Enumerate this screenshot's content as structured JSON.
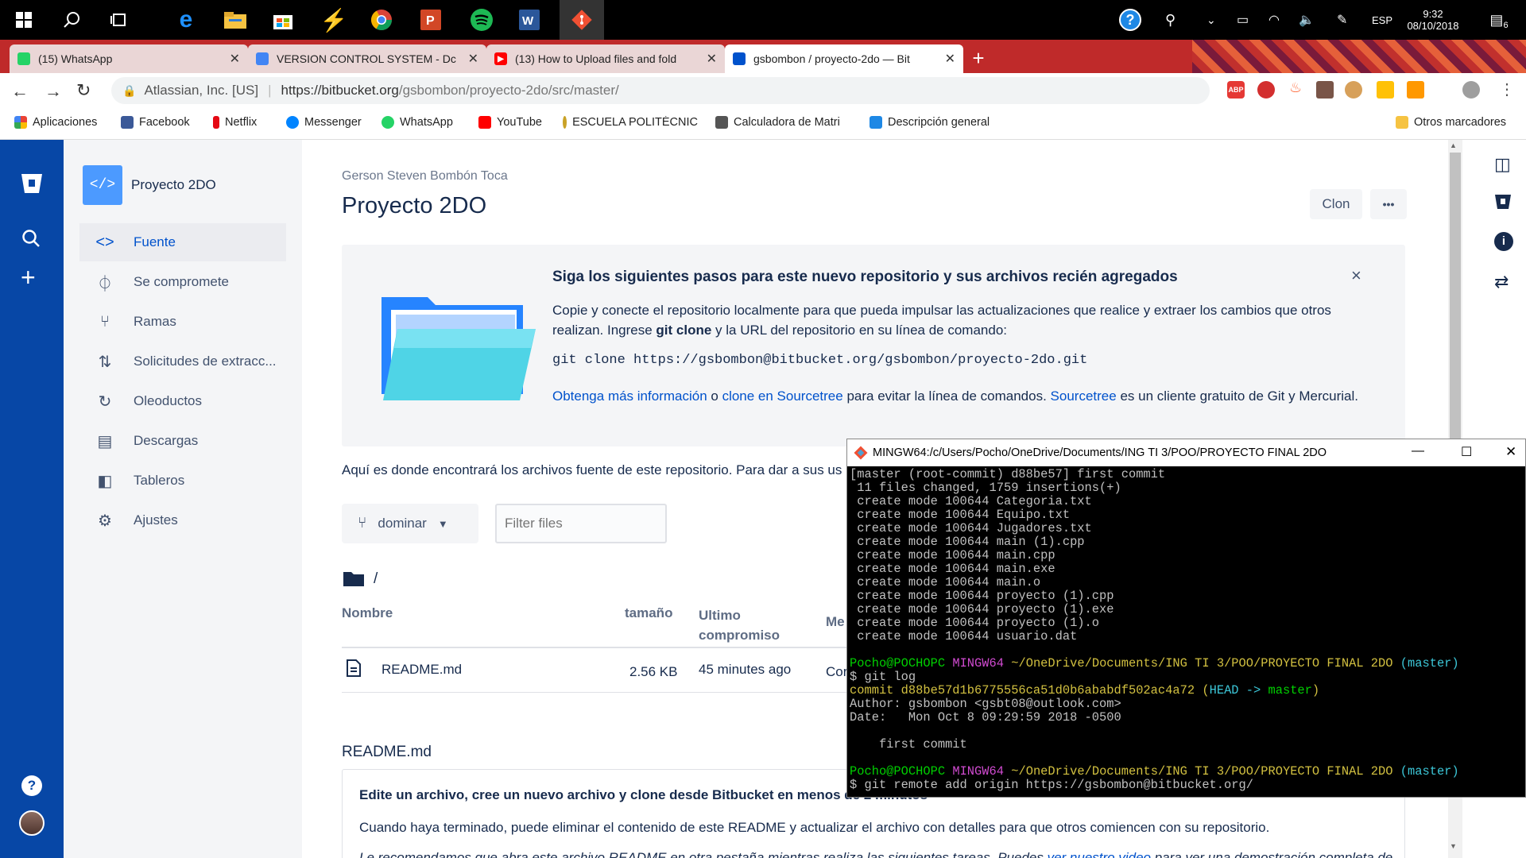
{
  "taskbar": {
    "lang": "ESP",
    "time": "9:32",
    "date": "08/10/2018",
    "notif": "6",
    "help": "?"
  },
  "tabs": [
    {
      "label": "(15) WhatsApp",
      "color": "#25d366"
    },
    {
      "label": "VERSION CONTROL SYSTEM - Dc",
      "color": "#4285f4"
    },
    {
      "label": "(13) How to Upload files and fold",
      "color": "#ff0000"
    },
    {
      "label": "gsbombon / proyecto-2do — Bit",
      "color": "#0052cc"
    }
  ],
  "address": {
    "owner": "Atlassian, Inc. [US]",
    "url_domain": "https://bitbucket.org",
    "url_path": "/gsbombon/proyecto-2do/src/master/"
  },
  "bookmarks": [
    "Aplicaciones",
    "Facebook",
    "Netflix",
    "Messenger",
    "WhatsApp",
    "YouTube",
    "ESCUELA POLITÉCNIC",
    "Calculadora de Matri",
    "Descripción general",
    "Otros marcadores"
  ],
  "sidebar": {
    "project": "Proyecto 2DO",
    "items": [
      "Fuente",
      "Se compromete",
      "Ramas",
      "Solicitudes de extracc...",
      "Oleoductos",
      "Descargas",
      "Tableros",
      "Ajustes"
    ]
  },
  "repo": {
    "owner": "Gerson Steven Bombón Toca",
    "title": "Proyecto 2DO",
    "clone_btn": "Clon",
    "more_btn": "•••"
  },
  "info": {
    "heading": "Siga los siguientes pasos para este nuevo repositorio y sus archivos recién agregados",
    "p1a": "Copie y conecte el repositorio localmente para que pueda impulsar las actualizaciones que realice y extraer los cambios que otros realizan. Ingrese ",
    "p1b": "git clone",
    "p1c": " y la URL del repositorio en su línea de comando:",
    "cmd": "git clone https://gsbombon@bitbucket.org/gsbombon/proyecto-2do.git",
    "l1": "Obtenga más información",
    "t1": " o ",
    "l2": "clone en Sourcetree",
    "t2": " para evitar la línea de comandos. ",
    "l3": "Sourcetree",
    "t3": " es un cliente gratuito de Git y Mercurial.",
    "close": "×"
  },
  "files": {
    "intro": "Aquí es donde encontrará los archivos fuente de este repositorio. Para dar a sus us",
    "branch": "dominar",
    "filter_placeholder": "Filter files",
    "path": "/",
    "headers": {
      "name": "Nombre",
      "size": "tamaño",
      "last1": "Ultimo",
      "last2": "compromiso",
      "msg": "Me"
    },
    "rows": [
      {
        "name": "README.md",
        "size": "2.56 KB",
        "time": "45 minutes ago",
        "msg": "Cor"
      }
    ]
  },
  "readme": {
    "title": "README.md",
    "heading": "Edite un archivo, cree un nuevo archivo y clone desde Bitbucket en menos de 2 minutos",
    "p1": "Cuando haya terminado, puede eliminar el contenido de este README y actualizar el archivo con detalles para que otros comiencen con su repositorio.",
    "p2a": "Le recomendamos que abra este archivo README en otra pestaña mientras realiza las siguientes tareas. Puedes ",
    "p2link": "ver nuestro video",
    "p2b": " para ver una demostración completa de"
  },
  "terminal": {
    "title": "MINGW64:/c/Users/Pocho/OneDrive/Documents/ING TI 3/POO/PROYECTO FINAL 2DO",
    "lines": [
      "[master (root-commit) d88be57] first commit",
      " 11 files changed, 1759 insertions(+)",
      " create mode 100644 Categoria.txt",
      " create mode 100644 Equipo.txt",
      " create mode 100644 Jugadores.txt",
      " create mode 100644 main (1).cpp",
      " create mode 100644 main.cpp",
      " create mode 100644 main.exe",
      " create mode 100644 main.o",
      " create mode 100644 proyecto (1).cpp",
      " create mode 100644 proyecto (1).exe",
      " create mode 100644 proyecto (1).o",
      " create mode 100644 usuario.dat",
      ""
    ],
    "prompt_user": "Pocho@POCHOPC",
    "prompt_env": "MINGW64",
    "prompt_path": "~/OneDrive/Documents/ING TI 3/POO/PROYECTO FINAL 2DO",
    "prompt_branch": "(master)",
    "cmd1": "$ git log",
    "commit_label": "commit d88be57d1b6775556ca51d0b6ababdf502ac4a72",
    "head_open": "(",
    "head_text": "HEAD -> ",
    "head_master": "master",
    "head_close": ")",
    "author": "Author: gsbombon <gsbt08@outlook.com>",
    "date": "Date:   Mon Oct 8 09:29:59 2018 -0500",
    "msg": "    first commit",
    "cmd2": "$ git remote add origin https://gsbombon@bitbucket.org/"
  }
}
